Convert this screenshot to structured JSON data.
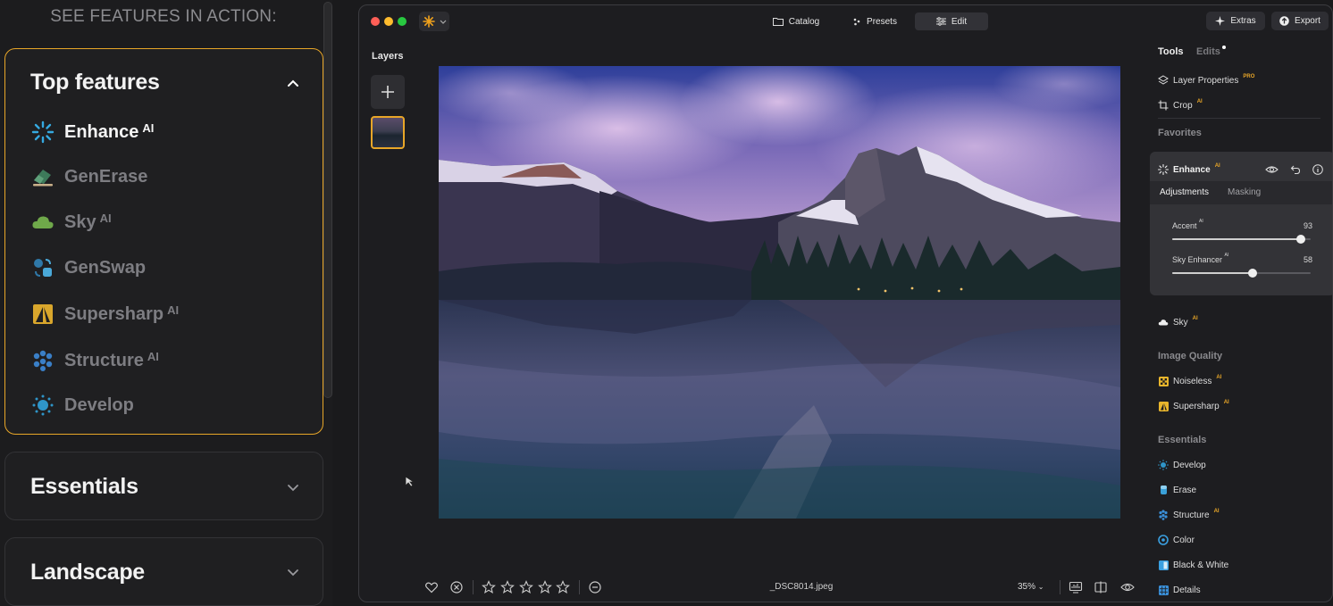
{
  "left_panel": {
    "heading": "SEE FEATURES IN ACTION:",
    "sections": [
      {
        "title": "Top features",
        "expanded": true,
        "features": [
          {
            "label": "Enhance",
            "ai": "AI",
            "icon": "enhance-burst-icon",
            "active": true
          },
          {
            "label": "GenErase",
            "ai": "",
            "icon": "eraser-icon",
            "active": false
          },
          {
            "label": "Sky",
            "ai": "AI",
            "icon": "cloud-icon",
            "active": false
          },
          {
            "label": "GenSwap",
            "ai": "",
            "icon": "swap-icon",
            "active": false
          },
          {
            "label": "Supersharp",
            "ai": "AI",
            "icon": "supersharp-icon",
            "active": false
          },
          {
            "label": "Structure",
            "ai": "AI",
            "icon": "structure-dots-icon",
            "active": false
          },
          {
            "label": "Develop",
            "ai": "",
            "icon": "develop-sun-icon",
            "active": false
          }
        ]
      },
      {
        "title": "Essentials",
        "expanded": false
      },
      {
        "title": "Landscape",
        "expanded": false
      }
    ]
  },
  "window": {
    "tabs": [
      {
        "label": "Catalog",
        "icon": "folder-icon",
        "active": false
      },
      {
        "label": "Presets",
        "icon": "presets-sparkle-icon",
        "active": false
      },
      {
        "label": "Edit",
        "icon": "sliders-icon",
        "active": true
      }
    ],
    "extras_label": "Extras",
    "export_label": "Export",
    "layers_title": "Layers"
  },
  "bottom_bar": {
    "filename": "_DSC8014.jpeg",
    "zoom": "35%",
    "rating_stars": 5,
    "rating_value": 0
  },
  "tools_panel": {
    "tabs": [
      "Tools",
      "Edits"
    ],
    "active_tab": "Tools",
    "top_tools": [
      {
        "label": "Layer Properties",
        "badge": "PRO"
      },
      {
        "label": "Crop",
        "badge": "AI"
      }
    ],
    "favorites_title": "Favorites",
    "enhance_card": {
      "title": "Enhance",
      "badge": "AI",
      "tabs": [
        "Adjustments",
        "Masking"
      ],
      "active_tab": "Adjustments",
      "sliders": [
        {
          "label": "Accent",
          "badge": "AI",
          "value": "93",
          "fraction": 0.93
        },
        {
          "label": "Sky Enhancer",
          "badge": "AI",
          "value": "58",
          "fraction": 0.58
        }
      ]
    },
    "sky_tool": {
      "label": "Sky",
      "badge": "AI"
    },
    "image_quality_title": "Image Quality",
    "image_quality_tools": [
      {
        "label": "Noiseless",
        "badge": "AI"
      },
      {
        "label": "Supersharp",
        "badge": "AI"
      }
    ],
    "essentials_title": "Essentials",
    "essentials_tools": [
      {
        "label": "Develop",
        "badge": ""
      },
      {
        "label": "Erase",
        "badge": ""
      },
      {
        "label": "Structure",
        "badge": "AI"
      },
      {
        "label": "Color",
        "badge": ""
      },
      {
        "label": "Black & White",
        "badge": ""
      },
      {
        "label": "Details",
        "badge": ""
      }
    ]
  },
  "colors": {
    "accent_orange": "#e8a628",
    "enhance_blue": "#35a9e0",
    "sky_green": "#6fa84a",
    "structure_blue": "#3a7fc7"
  }
}
